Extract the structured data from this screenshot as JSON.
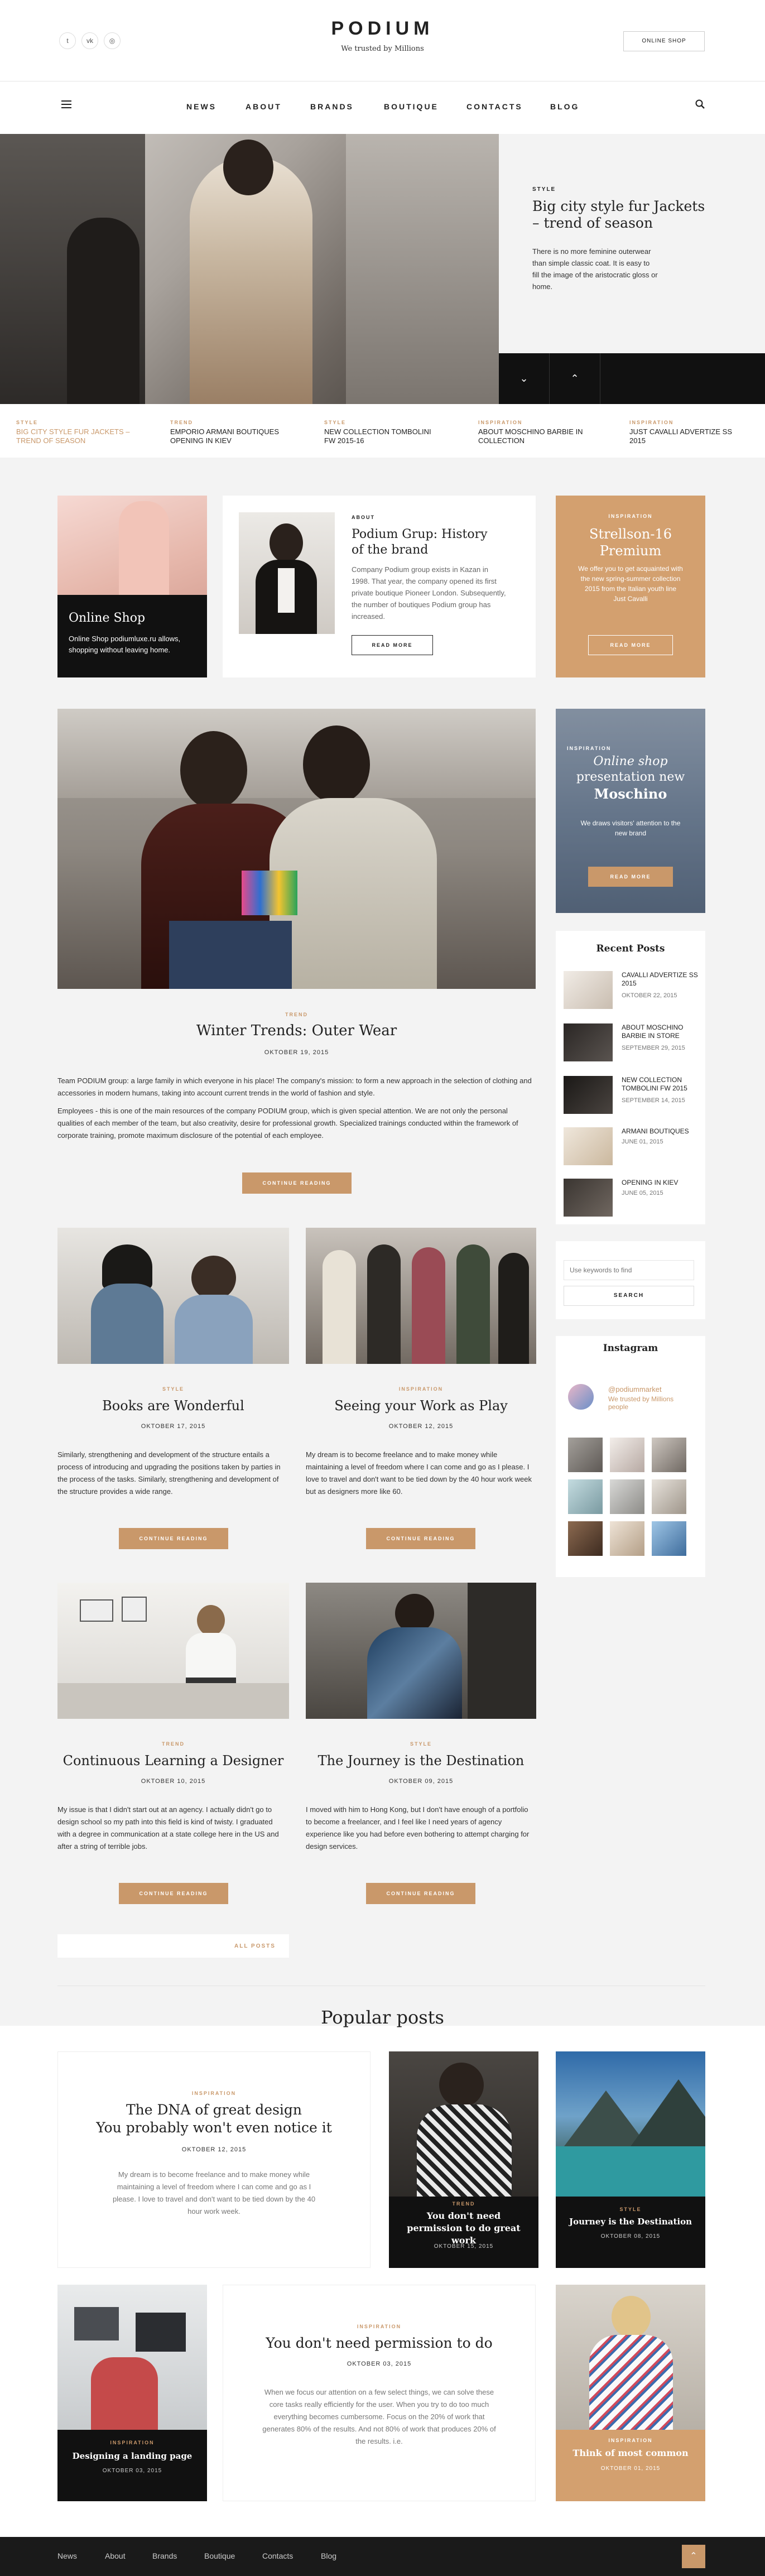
{
  "header": {
    "logo": "PODIUM",
    "tagline": "We trusted by Millions",
    "online_shop_button": "ONLINE SHOP",
    "social": [
      "twitter-icon",
      "vk-icon",
      "instagram-icon"
    ]
  },
  "nav": {
    "items": [
      "NEWS",
      "ABOUT",
      "BRANDS",
      "BOUTIQUE",
      "CONTACTS",
      "BLOG"
    ]
  },
  "hero": {
    "tag": "STYLE",
    "title": "Big city style fur Jackets – trend of season",
    "text": "There is no more feminine outerwear than simple classic coat. It is easy to fill the image of the aristocratic gloss or home."
  },
  "ticker": [
    {
      "tag": "STYLE",
      "title": "BIG CITY STYLE FUR JACKETS – TREND OF SEASON",
      "active": true
    },
    {
      "tag": "TREND",
      "title": "EMPORIO ARMANI BOUTIQUES OPENING IN KIEV"
    },
    {
      "tag": "STYLE",
      "title": "NEW COLLECTION TOMBOLINI FW 2015-16"
    },
    {
      "tag": "INSPIRATION",
      "title": "ABOUT MOSCHINO BARBIE IN COLLECTION"
    },
    {
      "tag": "INSPIRATION",
      "title": "JUST CAVALLI ADVERTIZE SS 2015"
    }
  ],
  "online_shop_card": {
    "title": "Online Shop",
    "text": "Online Shop podiumluxe.ru allows, shopping without leaving home."
  },
  "about_card": {
    "tag": "ABOUT",
    "title": "Podium Grup: History of the brand",
    "text": "Company Podium group exists in Kazan in 1998. That year, the company opened its first private boutique Pioneer London. Subsequently, the number of boutiques Podium group has increased.",
    "button": "READ MORE"
  },
  "promo_card": {
    "tag": "INSPIRATION",
    "title": "Strellson-16 Premium",
    "text": "We offer you to get acquainted with the new spring-summer collection 2015 from the Italian youth line Just Cavalli",
    "button": "READ MORE"
  },
  "moschino_card": {
    "tag": "INSPIRATION",
    "title_line1": "Online shop",
    "title_line2": "presentation new",
    "title_line3": "Moschino",
    "text": "We draws visitors' attention to the new brand",
    "button": "READ MORE"
  },
  "main_post": {
    "tag": "TREND",
    "title": "Winter Trends: Outer Wear",
    "date": "OKTOBER 19, 2015",
    "p1": "Team PODIUM group: a large family in which everyone in his place! The company's mission: to form a new approach in the selection of clothing and accessories in modern humans, taking into account current trends in the world of fashion and style.",
    "p2": "Employees - this is one of the main resources of the company PODIUM group, which is given special attention. We are not only the personal qualities of each member of the team, but also creativity, desire for professional growth. Specialized trainings conducted within the framework of corporate training, promote maximum disclosure of the potential of each employee.",
    "button": "CONTINUE READING"
  },
  "grid_posts": [
    {
      "tag": "STYLE",
      "title": "Books are Wonderful",
      "date": "OKTOBER 17, 2015",
      "text": "Similarly, strengthening and development of the structure entails a process of introducing and upgrading the positions taken by parties in the process of the tasks. Similarly, strengthening and development of the structure provides a wide range.",
      "button": "CONTINUE READING"
    },
    {
      "tag": "INSPIRATION",
      "title": "Seeing your Work as Play",
      "date": "OKTOBER 12, 2015",
      "text": "My dream is to become freelance and to make money while maintaining a level of freedom where I can come and go as I please. I love to travel and don't want to be tied down by the 40 hour work week but as designers more like 60.",
      "button": "CONTINUE READING"
    },
    {
      "tag": "TREND",
      "title": "Continuous Learning a Designer",
      "date": "OKTOBER 10, 2015",
      "text": "My issue is that I didn't start out at an agency. I actually didn't go to design school so my path into this field is kind of twisty. I graduated with a degree in communication at a state college here in the US and after a string of terrible jobs.",
      "button": "CONTINUE READING"
    },
    {
      "tag": "STYLE",
      "title": "The Journey is the Destination",
      "date": "OKTOBER 09, 2015",
      "text": "I moved with him to Hong Kong, but I don't have enough of a portfolio to become a freelancer, and I feel like I need years of agency experience like you had before even bothering to attempt charging for design services.",
      "button": "CONTINUE READING"
    }
  ],
  "all_posts": "ALL POSTS",
  "sidebar": {
    "recent_title": "Recent Posts",
    "recent": [
      {
        "title": "CAVALLI ADVERTIZE SS 2015",
        "date": "OKTOBER 22, 2015"
      },
      {
        "title": "ABOUT MOSCHINO BARBIE IN STORE",
        "date": "SEPTEMBER 29, 2015"
      },
      {
        "title": "NEW COLLECTION TOMBOLINI FW 2015",
        "date": "SEPTEMBER 14, 2015"
      },
      {
        "title": "ARMANI BOUTIQUES",
        "date": "JUNE 01, 2015"
      },
      {
        "title": "OPENING IN KIEV",
        "date": "JUNE 05, 2015"
      }
    ],
    "search_placeholder": "Use keywords to find",
    "search_button": "SEARCH",
    "instagram_title": "Instagram",
    "instagram_user": "@podiummarket",
    "instagram_desc": "We trusted by Millions people"
  },
  "popular": {
    "title": "Popular posts",
    "feature1": {
      "tag": "INSPIRATION",
      "title_l1": "The DNA of great design",
      "title_l2": "You probably won't even notice it",
      "date": "OKTOBER 12, 2015",
      "text": "My dream is to become freelance and to make money while maintaining a level of freedom where I can come and go as I please. I love to travel and don't want to be tied down by the 40 hour work week."
    },
    "card_a": {
      "tag": "TREND",
      "title": "You don't need permission to do great work",
      "date": "OKTOBER 15, 2015"
    },
    "card_b": {
      "tag": "STYLE",
      "title": "Journey is the Destination",
      "date": "OKTOBER 08, 2015"
    },
    "card_c": {
      "tag": "INSPIRATION",
      "title": "Designing a landing page",
      "date": "OKTOBER 03, 2015"
    },
    "feature2": {
      "tag": "INSPIRATION",
      "title": "You don't need permission to do",
      "date": "OKTOBER 03, 2015",
      "text": "When we focus our attention on a few select things, we can solve these core tasks really efficiently for the user. When you try to do too much everything becomes cumbersome. Focus on the 20% of work that generates 80% of the results. And not 80% of work that produces 20% of the results. i.e."
    },
    "card_d": {
      "tag": "INSPIRATION",
      "title": "Think of most common",
      "date": "OKTOBER 01, 2015"
    }
  },
  "footer": {
    "links": [
      "News",
      "About",
      "Brands",
      "Boutique",
      "Contacts",
      "Blog"
    ]
  },
  "colors": {
    "accent": "#c9986a",
    "dark": "#111111",
    "light_bg": "#f3f3f3"
  }
}
